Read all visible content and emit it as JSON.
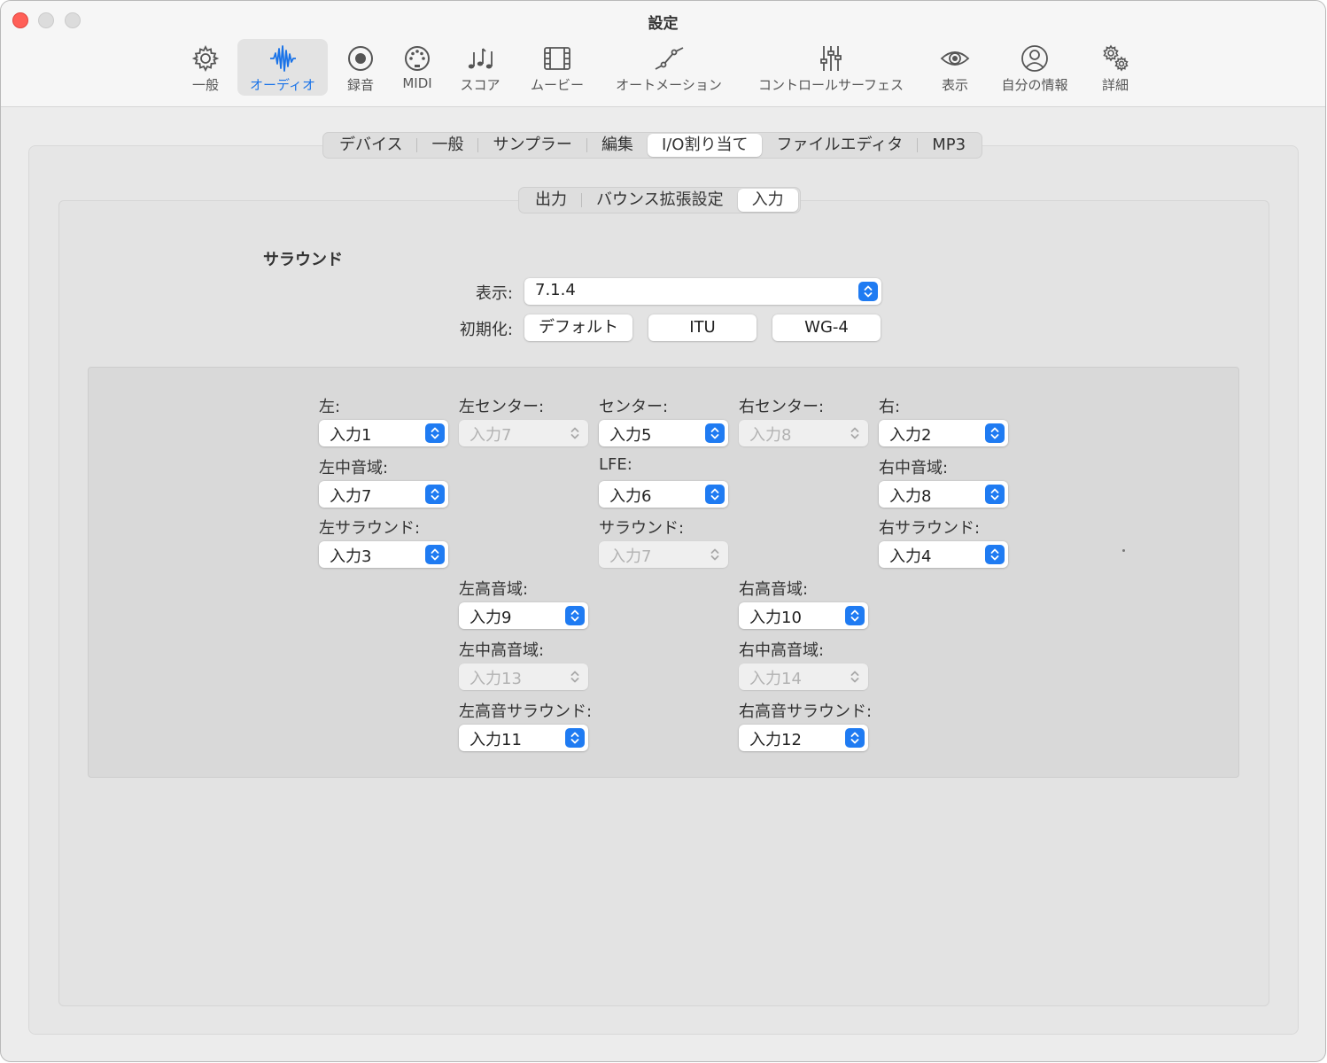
{
  "window": {
    "title": "設定"
  },
  "toolbar": [
    {
      "label": "一般",
      "icon": "gear-icon"
    },
    {
      "label": "オーディオ",
      "icon": "waveform-icon"
    },
    {
      "label": "録音",
      "icon": "record-icon"
    },
    {
      "label": "MIDI",
      "icon": "midi-icon"
    },
    {
      "label": "スコア",
      "icon": "music-notes-icon"
    },
    {
      "label": "ムービー",
      "icon": "film-icon"
    },
    {
      "label": "オートメーション",
      "icon": "automation-icon"
    },
    {
      "label": "コントロールサーフェス",
      "icon": "sliders-icon"
    },
    {
      "label": "表示",
      "icon": "eye-icon"
    },
    {
      "label": "自分の情報",
      "icon": "person-icon"
    },
    {
      "label": "詳細",
      "icon": "gears-icon"
    }
  ],
  "tabs": [
    "デバイス",
    "一般",
    "サンプラー",
    "編集",
    "I/O割り当て",
    "ファイルエディタ",
    "MP3"
  ],
  "subtabs": [
    "出力",
    "バウンス拡張設定",
    "入力"
  ],
  "surround": {
    "title": "サラウンド",
    "display_label": "表示:",
    "display_value": "7.1.4",
    "init_label": "初期化:",
    "init_buttons": [
      "デフォルト",
      "ITU",
      "WG-4"
    ]
  },
  "channels": {
    "left": {
      "label": "左:",
      "value": "入力1"
    },
    "left_center": {
      "label": "左センター:",
      "value": "入力7"
    },
    "center": {
      "label": "センター:",
      "value": "入力5"
    },
    "right_center": {
      "label": "右センター:",
      "value": "入力8"
    },
    "right": {
      "label": "右:",
      "value": "入力2"
    },
    "left_mid": {
      "label": "左中音域:",
      "value": "入力7"
    },
    "lfe": {
      "label": "LFE:",
      "value": "入力6"
    },
    "right_mid": {
      "label": "右中音域:",
      "value": "入力8"
    },
    "left_surround": {
      "label": "左サラウンド:",
      "value": "入力3"
    },
    "surround": {
      "label": "サラウンド:",
      "value": "入力7"
    },
    "right_surround": {
      "label": "右サラウンド:",
      "value": "入力4"
    },
    "left_high": {
      "label": "左高音域:",
      "value": "入力9"
    },
    "right_high": {
      "label": "右高音域:",
      "value": "入力10"
    },
    "left_mid_high": {
      "label": "左中高音域:",
      "value": "入力13"
    },
    "right_mid_high": {
      "label": "右中高音域:",
      "value": "入力14"
    },
    "left_high_surround": {
      "label": "左高音サラウンド:",
      "value": "入力11"
    },
    "right_high_surround": {
      "label": "右高音サラウンド:",
      "value": "入力12"
    }
  },
  "colors": {
    "accent": "#1f7bf2",
    "close": "#ff5f57"
  }
}
